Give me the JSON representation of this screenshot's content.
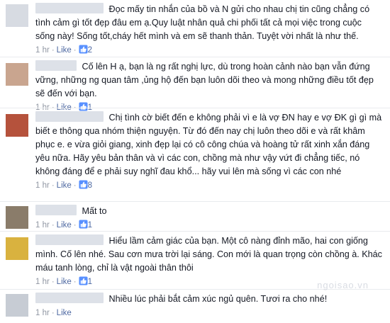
{
  "comments": [
    {
      "text": "Đọc mấy tin nhắn của bồ và N gửi cho nhau chị tin cũng chẳng có tình cảm gì tốt đẹp đâu em ạ.Quy luật nhân quả chi phối tất cả mọi việc trong cuộc sống này! Sống tốt,cháy hết mình và em sẽ thanh thản. Tuyệt vời nhất là như thế.",
      "time": "1 hr",
      "like_label": "Like",
      "likes": "2"
    },
    {
      "text": "Cố lên H ạ, bạn là ng rất nghị lực, dù trong hoàn cảnh nào bạn vẫn đứng vững, những ng quan tâm ,ủng hộ đến bạn luôn dõi theo và mong những điều tốt đẹp sẽ đến với bạn.",
      "time": "1 hr",
      "like_label": "Like",
      "likes": "1"
    },
    {
      "text": "Chị tình cờ biết đến e không phải vì e là vợ ĐN hay e vợ ĐK gì gì mà biết e thông qua nhóm thiện nguyện. Từ đó đến nay chị luôn theo dõi e và rất khâm phục e. e vừa giỏi giang, xinh đẹp lại có cô công chúa và hoàng tử rất xinh xắn đáng yêu nữa. Hãy yêu bản thân và vì các con, chồng mà như vậy vứt đi chẳng tiếc, nó không đáng để e phải suy nghĩ đau khổ... hãy vui lên mà sống vì các con nhé",
      "time": "1 hr",
      "like_label": "Like",
      "likes": "8"
    },
    {
      "text": "Mất to",
      "time": "1 hr",
      "like_label": "Like",
      "likes": "1"
    },
    {
      "text": "Hiểu lầm cảm giác của bạn. Một cô nàng đỉnh mão, hai con giống mình. Cố lên nhé. Sau cơn mưa trời lại sáng. Con mới là quan trọng còn chồng à. Khác máu tanh lòng, chỉ là vật ngoài thân thôi",
      "time": "1 hr",
      "like_label": "Like",
      "likes": "1"
    },
    {
      "text": "Nhiều lúc phải bắt cảm xúc ngủ quên. Tươi ra cho nhé!",
      "time": "1 hr",
      "like_label": "Like",
      "likes": ""
    }
  ],
  "watermark": "ngoisao.vn",
  "colors": {
    "link": "#4e69a2",
    "meta": "#9197a3",
    "text": "#141823",
    "divider": "#e9ebee"
  }
}
